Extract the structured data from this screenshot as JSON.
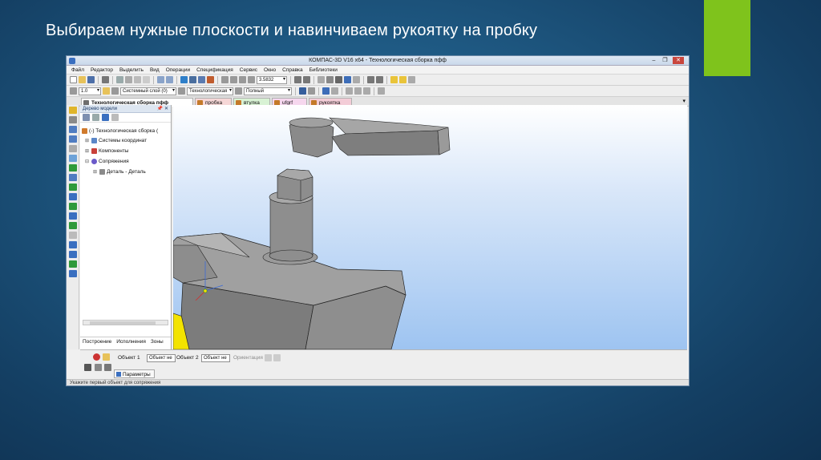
{
  "slide": {
    "title": "Выбираем нужные плоскости и навинчиваем рукоятку на пробку",
    "accent_color": "#7fc31c"
  },
  "window": {
    "title": "КОМПАС-3D V16  x64 - Технологическая сборка пфф",
    "controls": [
      "minimize-icon",
      "maximize-icon",
      "close-icon"
    ]
  },
  "menu": [
    "Файл",
    "Редактор",
    "Выделить",
    "Вид",
    "Операции",
    "Спецификация",
    "Сервис",
    "Окно",
    "Справка",
    "Библиотеки"
  ],
  "toolbar1": {
    "zoom_value": "3.5832"
  },
  "toolbar2": {
    "step_value": "1.0",
    "layer_value": "Системный слой (0)",
    "assembly_value": "Технологическая",
    "view_mode_value": "Полный"
  },
  "doc_tabs": [
    "Технологическая сборка пфф",
    "пробка",
    "втулка",
    "ufgrf",
    "рукоятка"
  ],
  "tree": {
    "header": "Дерево модели",
    "items": [
      "(-) Технологическая сборка (",
      "Системы координат",
      "Компоненты",
      "Сопряжения",
      "Деталь - Деталь"
    ],
    "tabs": [
      "Построение",
      "Исполнения",
      "Зоны"
    ]
  },
  "properties": {
    "object1_label": "Объект 1",
    "object1_value": "Объект не",
    "object2_label": "Объект 2",
    "object2_value": "Объект не",
    "orientation_label": "Ориентация",
    "params_tab": "Параметры"
  },
  "status": {
    "text": "Укажите первый объект для сопряжения"
  },
  "scene": {
    "bg_top": "#ffffff",
    "bg_bottom": "#9ec4f1",
    "part_color": "#8a8a8a",
    "highlight_color": "#f0e000"
  }
}
